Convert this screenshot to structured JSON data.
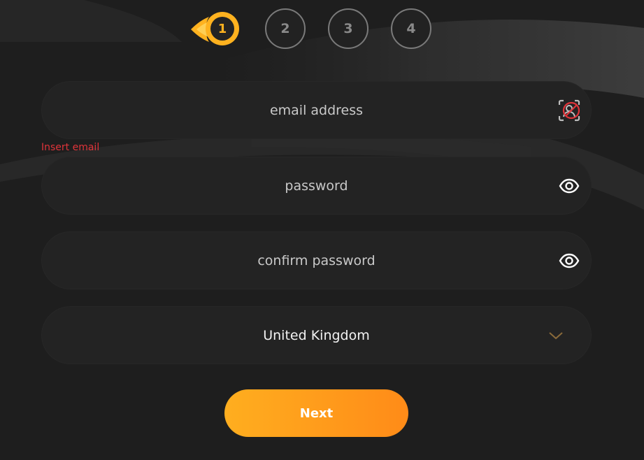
{
  "stepper": {
    "steps": [
      {
        "label": "1",
        "state": "active"
      },
      {
        "label": "2",
        "state": "inactive"
      },
      {
        "label": "3",
        "state": "inactive"
      },
      {
        "label": "4",
        "state": "inactive"
      }
    ]
  },
  "form": {
    "email": {
      "placeholder": "email address",
      "icon": "id-scan-icon",
      "error": "Insert email"
    },
    "password": {
      "placeholder": "password",
      "icon": "eye-icon"
    },
    "confirm_password": {
      "placeholder": "confirm password",
      "icon": "eye-icon"
    },
    "country": {
      "value": "United Kingdom",
      "icon": "chevron-down-icon"
    }
  },
  "actions": {
    "next_label": "Next"
  },
  "colors": {
    "background": "#1e1e1e",
    "field": "#232323",
    "accent": "#ffae1f",
    "accent_end": "#ff8b18",
    "error": "#e0343a",
    "inactive_step": "#7a7a7a"
  }
}
